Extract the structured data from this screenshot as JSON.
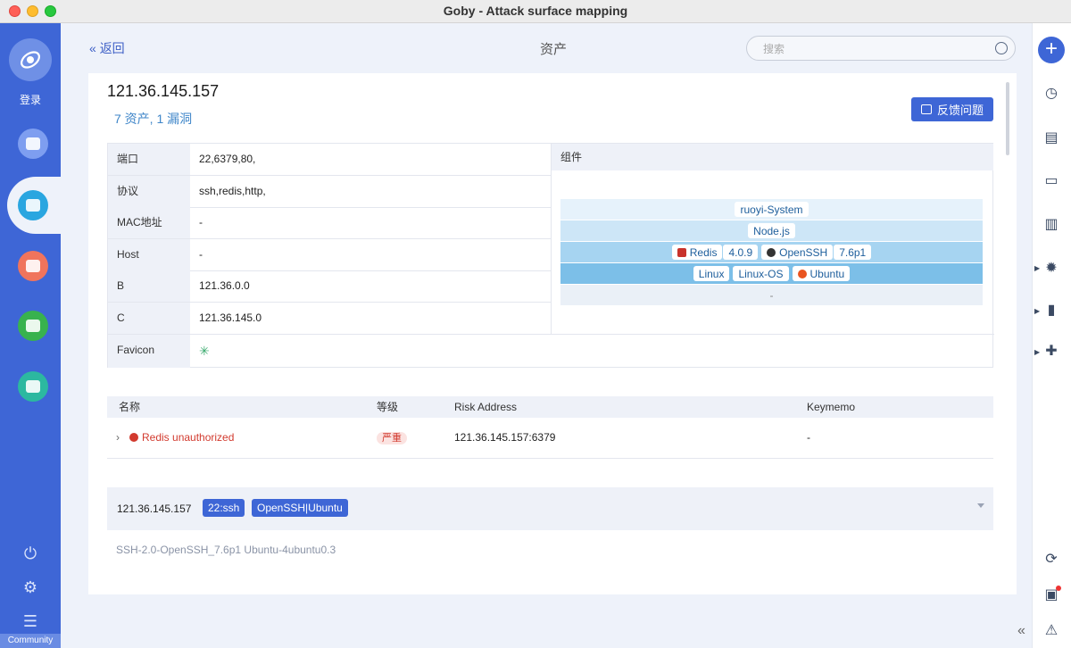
{
  "window": {
    "title": "Goby - Attack surface mapping"
  },
  "sidebar": {
    "login_label": "登录",
    "community_label": "Community"
  },
  "header": {
    "back_label": "返回",
    "page_title": "资产",
    "search_placeholder": "搜索"
  },
  "asset": {
    "ip": "121.36.145.157",
    "summary": "7 资产, 1 漏洞",
    "feedback_label": "反馈问题"
  },
  "info": {
    "rows": [
      {
        "key": "端口",
        "value": "22,6379,80,"
      },
      {
        "key": "协议",
        "value": "ssh,redis,http,"
      },
      {
        "key": "MAC地址",
        "value": "-"
      },
      {
        "key": "Host",
        "value": "-"
      },
      {
        "key": "B",
        "value": "121.36.0.0"
      },
      {
        "key": "C",
        "value": "121.36.145.0"
      }
    ],
    "favicon_key": "Favicon",
    "components_header": "组件",
    "components": {
      "layer1": "ruoyi-System",
      "layer2": "Node.js",
      "layer3": [
        {
          "name": "Redis",
          "version": "4.0.9"
        },
        {
          "name": "OpenSSH",
          "version": "7.6p1"
        }
      ],
      "layer4": [
        "Linux",
        "Linux-OS",
        "Ubuntu"
      ],
      "layer5": "-"
    },
    "layer_colors": [
      "#e6f2fb",
      "#cde6f7",
      "#a6d4f1",
      "#7cbfe8",
      "#eaf0f7"
    ]
  },
  "vulns": {
    "headers": {
      "name": "名称",
      "level": "等级",
      "address": "Risk Address",
      "keymemo": "Keymemo"
    },
    "rows": [
      {
        "name": "Redis unauthorized",
        "level": "严重",
        "address": "121.36.145.157:6379",
        "keymemo": "-"
      }
    ]
  },
  "port_section": {
    "ip": "121.36.145.157",
    "port_tag": "22:ssh",
    "product_tag": "OpenSSH|Ubuntu",
    "banner": "SSH-2.0-OpenSSH_7.6p1 Ubuntu-4ubuntu0.3"
  },
  "colors": {
    "accent": "#3e66d6",
    "danger": "#d23a2e",
    "link": "#3f86c9"
  }
}
